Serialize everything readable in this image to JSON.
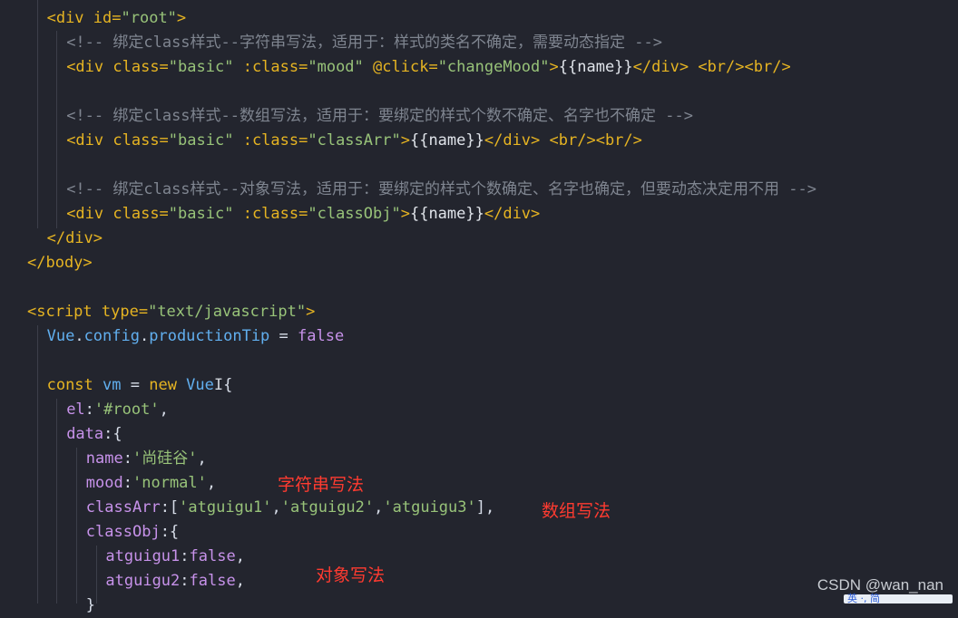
{
  "lines": [
    {
      "indent": "  ",
      "parts": [
        [
          "tag",
          "<div "
        ],
        [
          "attr",
          "id="
        ],
        [
          "str",
          "\"root\""
        ],
        [
          "tag",
          ">"
        ]
      ]
    },
    {
      "indent": "    ",
      "parts": [
        [
          "cmt",
          "<!-- 绑定class样式--字符串写法，适用于：样式的类名不确定，需要动态指定 -->"
        ]
      ]
    },
    {
      "indent": "    ",
      "parts": [
        [
          "tag",
          "<div "
        ],
        [
          "attr",
          "class="
        ],
        [
          "str",
          "\"basic\""
        ],
        [
          "sym",
          " "
        ],
        [
          "attr",
          ":class="
        ],
        [
          "str",
          "\"mood\""
        ],
        [
          "sym",
          " "
        ],
        [
          "attr",
          "@click="
        ],
        [
          "str",
          "\"changeMood\""
        ],
        [
          "tag",
          ">"
        ],
        [
          "txt",
          "{{name}}"
        ],
        [
          "tag",
          "</div>"
        ],
        [
          "sym",
          " "
        ],
        [
          "tag",
          "<br/><br/>"
        ]
      ]
    },
    {
      "indent": "",
      "parts": []
    },
    {
      "indent": "    ",
      "parts": [
        [
          "cmt",
          "<!-- 绑定class样式--数组写法，适用于：要绑定的样式个数不确定、名字也不确定 -->"
        ]
      ]
    },
    {
      "indent": "    ",
      "parts": [
        [
          "tag",
          "<div "
        ],
        [
          "attr",
          "class="
        ],
        [
          "str",
          "\"basic\""
        ],
        [
          "sym",
          " "
        ],
        [
          "attr",
          ":class="
        ],
        [
          "str",
          "\"classArr\""
        ],
        [
          "tag",
          ">"
        ],
        [
          "txt",
          "{{name}}"
        ],
        [
          "tag",
          "</div>"
        ],
        [
          "sym",
          " "
        ],
        [
          "tag",
          "<br/><br/>"
        ]
      ]
    },
    {
      "indent": "",
      "parts": []
    },
    {
      "indent": "    ",
      "parts": [
        [
          "cmt",
          "<!-- 绑定class样式--对象写法，适用于：要绑定的样式个数确定、名字也确定，但要动态决定用不用 -->"
        ]
      ]
    },
    {
      "indent": "    ",
      "parts": [
        [
          "tag",
          "<div "
        ],
        [
          "attr",
          "class="
        ],
        [
          "str",
          "\"basic\""
        ],
        [
          "sym",
          " "
        ],
        [
          "attr",
          ":class="
        ],
        [
          "str",
          "\"classObj\""
        ],
        [
          "tag",
          ">"
        ],
        [
          "txt",
          "{{name}}"
        ],
        [
          "tag",
          "</div>"
        ]
      ]
    },
    {
      "indent": "  ",
      "parts": [
        [
          "tag",
          "</div>"
        ]
      ]
    },
    {
      "indent": "",
      "parts": [
        [
          "tag",
          "</body>"
        ]
      ]
    },
    {
      "indent": "",
      "parts": []
    },
    {
      "indent": "",
      "parts": [
        [
          "tag",
          "<script "
        ],
        [
          "attr",
          "type="
        ],
        [
          "str",
          "\"text/javascript\""
        ],
        [
          "tag",
          ">"
        ]
      ]
    },
    {
      "indent": "  ",
      "parts": [
        [
          "obj",
          "Vue"
        ],
        [
          "sym",
          "."
        ],
        [
          "obj",
          "config"
        ],
        [
          "sym",
          "."
        ],
        [
          "obj",
          "productionTip"
        ],
        [
          "sym",
          " = "
        ],
        [
          "lit",
          "false"
        ]
      ]
    },
    {
      "indent": "",
      "parts": []
    },
    {
      "indent": "  ",
      "parts": [
        [
          "kw",
          "const "
        ],
        [
          "obj",
          "vm"
        ],
        [
          "sym",
          " = "
        ],
        [
          "kw",
          "new "
        ],
        [
          "obj",
          "Vue"
        ],
        [
          "cursor",
          "I"
        ],
        [
          "sym",
          "{"
        ]
      ]
    },
    {
      "indent": "    ",
      "parts": [
        [
          "key",
          "el"
        ],
        [
          "sym",
          ":"
        ],
        [
          "jstr",
          "'#root'"
        ],
        [
          "sym",
          ","
        ]
      ]
    },
    {
      "indent": "    ",
      "parts": [
        [
          "key",
          "data"
        ],
        [
          "sym",
          ":{"
        ]
      ]
    },
    {
      "indent": "      ",
      "parts": [
        [
          "key",
          "name"
        ],
        [
          "sym",
          ":"
        ],
        [
          "jstr",
          "'尚硅谷'"
        ],
        [
          "sym",
          ","
        ]
      ]
    },
    {
      "indent": "      ",
      "parts": [
        [
          "key",
          "mood"
        ],
        [
          "sym",
          ":"
        ],
        [
          "jstr",
          "'normal'"
        ],
        [
          "sym",
          ","
        ]
      ]
    },
    {
      "indent": "      ",
      "parts": [
        [
          "key",
          "classArr"
        ],
        [
          "sym",
          ":["
        ],
        [
          "jstr",
          "'atguigu1'"
        ],
        [
          "sym",
          ","
        ],
        [
          "jstr",
          "'atguigu2'"
        ],
        [
          "sym",
          ","
        ],
        [
          "jstr",
          "'atguigu3'"
        ],
        [
          "sym",
          "],"
        ]
      ]
    },
    {
      "indent": "      ",
      "parts": [
        [
          "key",
          "classObj"
        ],
        [
          "sym",
          ":{"
        ]
      ]
    },
    {
      "indent": "        ",
      "parts": [
        [
          "key",
          "atguigu1"
        ],
        [
          "sym",
          ":"
        ],
        [
          "lit",
          "false"
        ],
        [
          "sym",
          ","
        ]
      ]
    },
    {
      "indent": "        ",
      "parts": [
        [
          "key",
          "atguigu2"
        ],
        [
          "sym",
          ":"
        ],
        [
          "lit",
          "false"
        ],
        [
          "sym",
          ","
        ]
      ]
    },
    {
      "indent": "      ",
      "parts": [
        [
          "sym",
          "}"
        ]
      ]
    }
  ],
  "annotations": {
    "string": "字符串写法",
    "array": "数组写法",
    "object": "对象写法"
  },
  "watermark": "CSDN @wan_nan",
  "ime_label": "英 ·, 简"
}
